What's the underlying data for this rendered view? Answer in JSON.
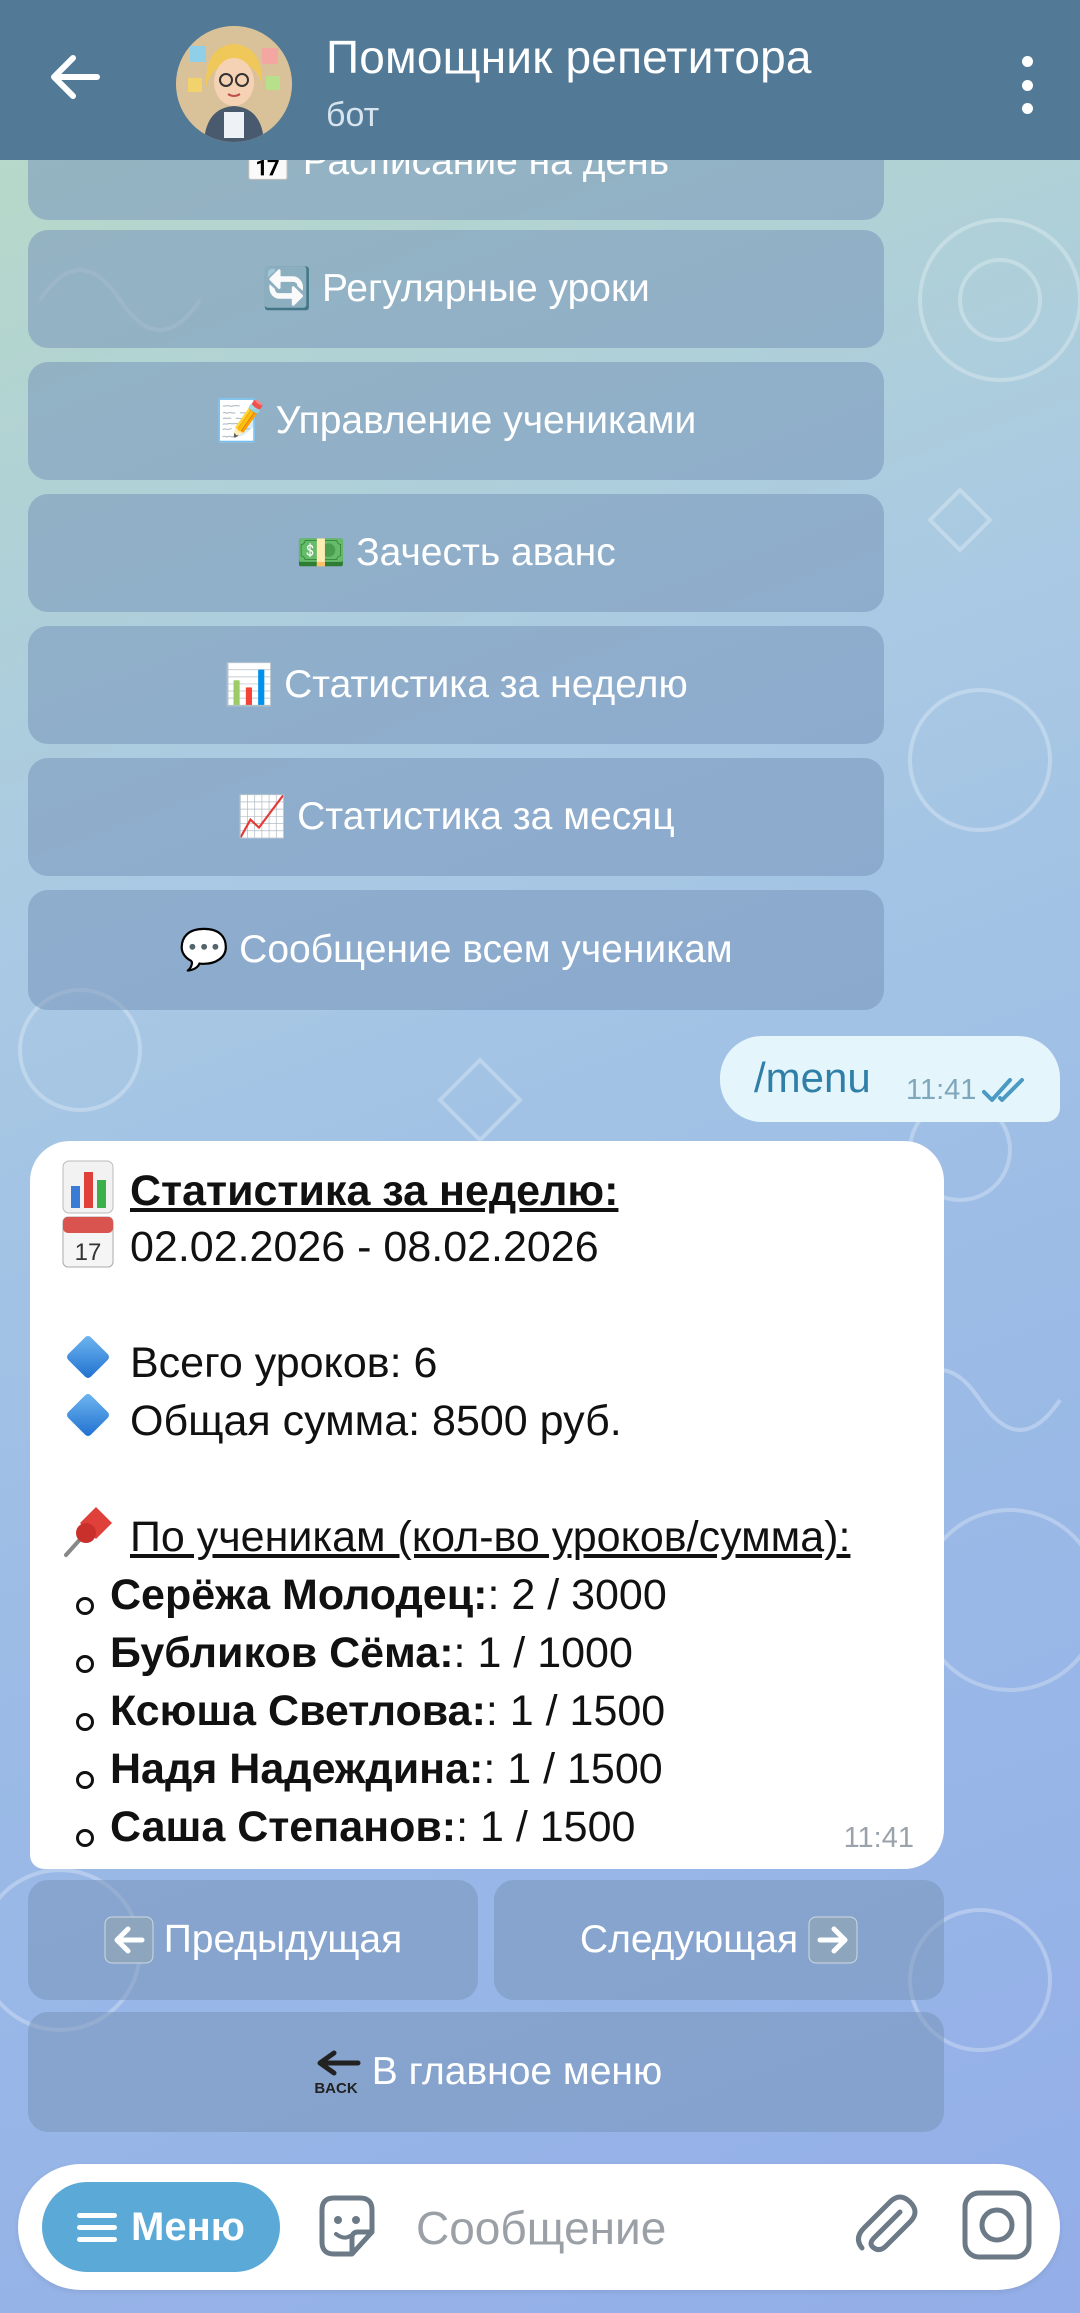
{
  "header": {
    "title": "Помощник репетитора",
    "subtitle": "бот"
  },
  "menu_buttons": [
    {
      "icon": "calendar-icon",
      "emoji": "📅",
      "label": "Расписание на день"
    },
    {
      "icon": "repeat-icon",
      "emoji": "🔄",
      "label": "Регулярные уроки"
    },
    {
      "icon": "memo-icon",
      "emoji": "📝",
      "label": "Управление учениками"
    },
    {
      "icon": "money-icon",
      "emoji": "💵",
      "label": "Зачесть аванс"
    },
    {
      "icon": "bar-chart-icon",
      "emoji": "📊",
      "label": "Статистика за неделю"
    },
    {
      "icon": "trend-chart-icon",
      "emoji": "📈",
      "label": "Статистика за месяц"
    },
    {
      "icon": "speech-bubble-icon",
      "emoji": "💬",
      "label": "Сообщение всем ученикам"
    }
  ],
  "outgoing": {
    "text": "/menu",
    "time": "11:41"
  },
  "stats": {
    "heading": "Статистика за неделю:",
    "period": "02.02.2026 - 08.02.2026",
    "total_lessons": "Всего уроков: 6",
    "total_sum": "Общая сумма: 8500 руб.",
    "by_students": "По ученикам (кол-во уроков/сумма):",
    "students": [
      {
        "name": "Серёжа Молодец:",
        "value": ": 2 / 3000"
      },
      {
        "name": "Бубликов Сёма:",
        "value": ": 1 / 1000"
      },
      {
        "name": "Ксюша Светлова:",
        "value": ": 1 / 1500"
      },
      {
        "name": "Надя Надеждина:",
        "value": ": 1 / 1500"
      },
      {
        "name": "Саша Степанов:",
        "value": ": 1 / 1500"
      }
    ],
    "time": "11:41"
  },
  "nav": {
    "prev": "Предыдущая",
    "next": "Следующая",
    "main_menu": "В главное меню"
  },
  "input": {
    "menu_label": "Меню",
    "placeholder": "Сообщение"
  },
  "colors": {
    "header": "#527a97",
    "menu_button": "#5aa9d6",
    "outgoing_bubble": "#e4f5fb"
  }
}
